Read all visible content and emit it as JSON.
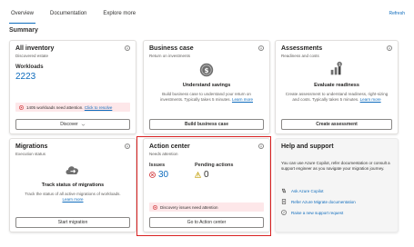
{
  "tabs": [
    {
      "label": "Overview",
      "active": true
    },
    {
      "label": "Documentation",
      "active": false
    },
    {
      "label": "Explore more",
      "active": false
    }
  ],
  "refresh_label": "Refresh",
  "summary_title": "Summary",
  "all_inventory": {
    "title": "All inventory",
    "subtitle": "Discovered estate",
    "workloads_label": "Workloads",
    "workloads_value": "2223",
    "alert_text": "1405 workloads need attention.",
    "alert_link": "Click to resolve",
    "button_label": "Discover"
  },
  "business_case": {
    "title": "Business case",
    "subtitle": "Return on investments",
    "heading": "Understand savings",
    "desc": "Build business case to understand your return on investments. Typically takes 5 minutes.",
    "learn_more": "Learn more",
    "button_label": "Build business case"
  },
  "assessments": {
    "title": "Assessments",
    "subtitle": "Readiness and costs",
    "heading": "Evaluate readiness",
    "desc": "Create assessment to understand readiness, right-sizing and costs. Typically takes 5 minutes.",
    "learn_more": "Learn more",
    "button_label": "Create assessment"
  },
  "migrations": {
    "title": "Migrations",
    "subtitle": "Execution status",
    "heading": "Track status of migrations",
    "desc": "Track the status of all active migrations of workloads.",
    "learn_more": "Learn more",
    "button_label": "Start migration"
  },
  "action_center": {
    "title": "Action center",
    "subtitle": "Needs attention",
    "issues_label": "Issues",
    "issues_value": "30",
    "pending_label": "Pending actions",
    "pending_value": "0",
    "alert_text": "Discovery issues need attention",
    "button_label": "Go to Action center"
  },
  "help": {
    "title": "Help and support",
    "desc": "You can use Azure Copilot, refer documentation or consult a support engineer as you navigate your migration journey.",
    "items": [
      {
        "label": "Ask Azure Copilot",
        "icon": "copilot-icon"
      },
      {
        "label": "Refer Azure Migrate documentation",
        "icon": "document-icon"
      },
      {
        "label": "Raise a new support request",
        "icon": "help-icon"
      }
    ]
  },
  "colors": {
    "accent": "#0f6cbd",
    "error": "#d13438",
    "warning": "#c19c00",
    "highlight": "#d92121"
  }
}
